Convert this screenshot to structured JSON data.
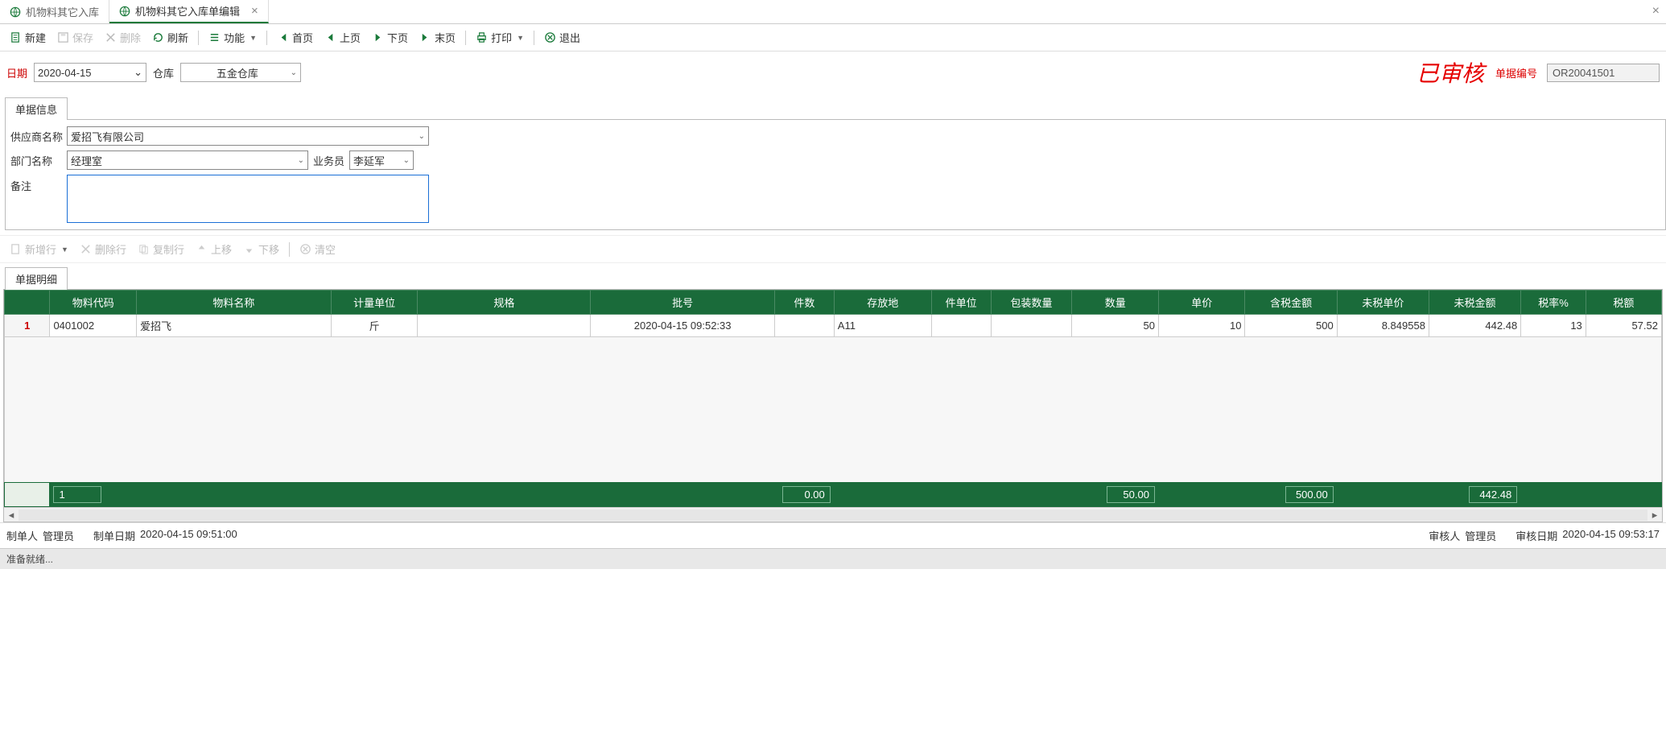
{
  "tabs": [
    {
      "label": "机物料其它入库"
    },
    {
      "label": "机物料其它入库单编辑"
    }
  ],
  "toolbar": {
    "new": "新建",
    "save": "保存",
    "delete": "删除",
    "refresh": "刷新",
    "func": "功能",
    "first": "首页",
    "prev": "上页",
    "next": "下页",
    "last": "末页",
    "print": "打印",
    "exit": "退出"
  },
  "header": {
    "date_label": "日期",
    "date_value": "2020-04-15",
    "wh_label": "仓库",
    "wh_value": "五金仓库",
    "approved": "已审核",
    "docno_label": "单据编号",
    "docno_value": "OR20041501"
  },
  "section_info_tab": "单据信息",
  "info": {
    "supplier_label": "供应商名称",
    "supplier_value": "爱招飞有限公司",
    "dept_label": "部门名称",
    "dept_value": "经理室",
    "sales_label": "业务员",
    "sales_value": "李延军",
    "remark_label": "备注",
    "remark_value": ""
  },
  "row_toolbar": {
    "add": "新增行",
    "del": "删除行",
    "copy": "复制行",
    "up": "上移",
    "down": "下移",
    "clear": "清空"
  },
  "section_detail_tab": "单据明细",
  "columns": [
    "物料代码",
    "物料名称",
    "计量单位",
    "规格",
    "批号",
    "件数",
    "存放地",
    "件单位",
    "包装数量",
    "数量",
    "单价",
    "含税金额",
    "未税单价",
    "未税金额",
    "税率%",
    "税额"
  ],
  "rows": [
    {
      "no": "1",
      "code": "0401002",
      "name": "爱招飞",
      "unit": "斤",
      "spec": "",
      "batch": "2020-04-15 09:52:33",
      "pcs": "",
      "loc": "A11",
      "pcunit": "",
      "pack": "",
      "qty": "50",
      "price": "10",
      "amt_tax": "500",
      "price_notax": "8.849558",
      "amt_notax": "442.48",
      "taxrate": "13",
      "tax": "57.52"
    }
  ],
  "totals": {
    "count": "1",
    "pcs": "0.00",
    "qty": "50.00",
    "amt_tax": "500.00",
    "amt_notax": "442.48"
  },
  "footer": {
    "maker_label": "制单人",
    "maker": "管理员",
    "make_date_label": "制单日期",
    "make_date": "2020-04-15 09:51:00",
    "auditor_label": "审核人",
    "auditor": "管理员",
    "audit_date_label": "审核日期",
    "audit_date": "2020-04-15 09:53:17"
  },
  "status": "准备就绪..."
}
